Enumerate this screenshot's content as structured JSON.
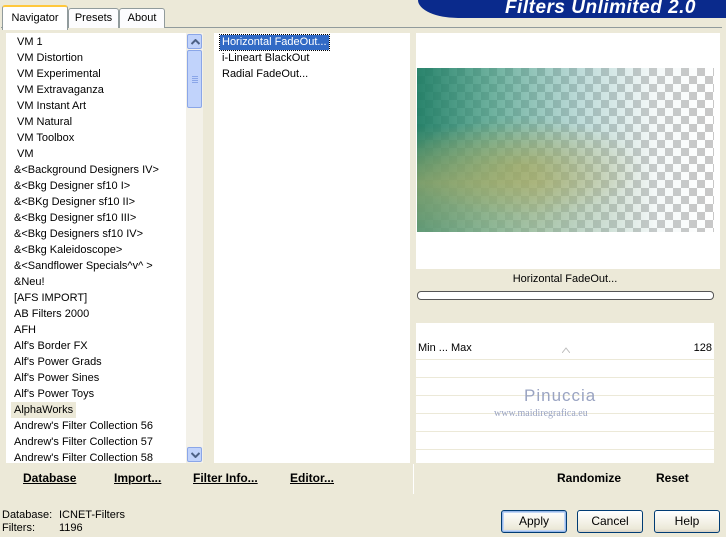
{
  "tabs": [
    "Navigator",
    "Presets",
    "About"
  ],
  "title": "Filters Unlimited 2.0",
  "categories": [
    "VM 1",
    "VM Distortion",
    "VM Experimental",
    "VM Extravaganza",
    "VM Instant Art",
    "VM Natural",
    "VM Toolbox",
    "VM",
    "&<Background Designers IV>",
    "&<Bkg Designer sf10 I>",
    "&<BKg Designer sf10 II>",
    "&<Bkg Designer sf10 III>",
    "&<Bkg Designers sf10 IV>",
    "&<Bkg Kaleidoscope>",
    "&<Sandflower Specials^v^ >",
    "&Neu!",
    "[AFS IMPORT]",
    "AB Filters 2000",
    "AFH",
    "Alf's Border FX",
    "Alf's Power Grads",
    "Alf's Power Sines",
    "Alf's Power Toys",
    "AlphaWorks",
    "Andrew's Filter Collection 56",
    "Andrew's Filter Collection 57",
    "Andrew's Filter Collection 58"
  ],
  "selected_category": "AlphaWorks",
  "filters": [
    "Horizontal FadeOut...",
    "i-Lineart BlackOut",
    "Radial FadeOut..."
  ],
  "selected_filter": "Horizontal FadeOut...",
  "filter_caption": "Horizontal FadeOut...",
  "slider": {
    "label": "Min ... Max",
    "value": "128"
  },
  "watermark": {
    "name": "Pinuccia",
    "site": "www.maidiregrafica.eu"
  },
  "bottom_links": {
    "database": "Database",
    "import": "Import...",
    "filter_info": "Filter Info...",
    "editor": "Editor...",
    "randomize": "Randomize",
    "reset": "Reset"
  },
  "status": {
    "database_label": "Database:",
    "database_value": "ICNET-Filters",
    "filters_label": "Filters:",
    "filters_value": "1196"
  },
  "buttons": {
    "apply": "Apply",
    "cancel": "Cancel",
    "help": "Help"
  },
  "colors": {
    "selection": "#316ac5",
    "banner": "#0a2a8c",
    "tab_accent": "#ffc83c"
  }
}
